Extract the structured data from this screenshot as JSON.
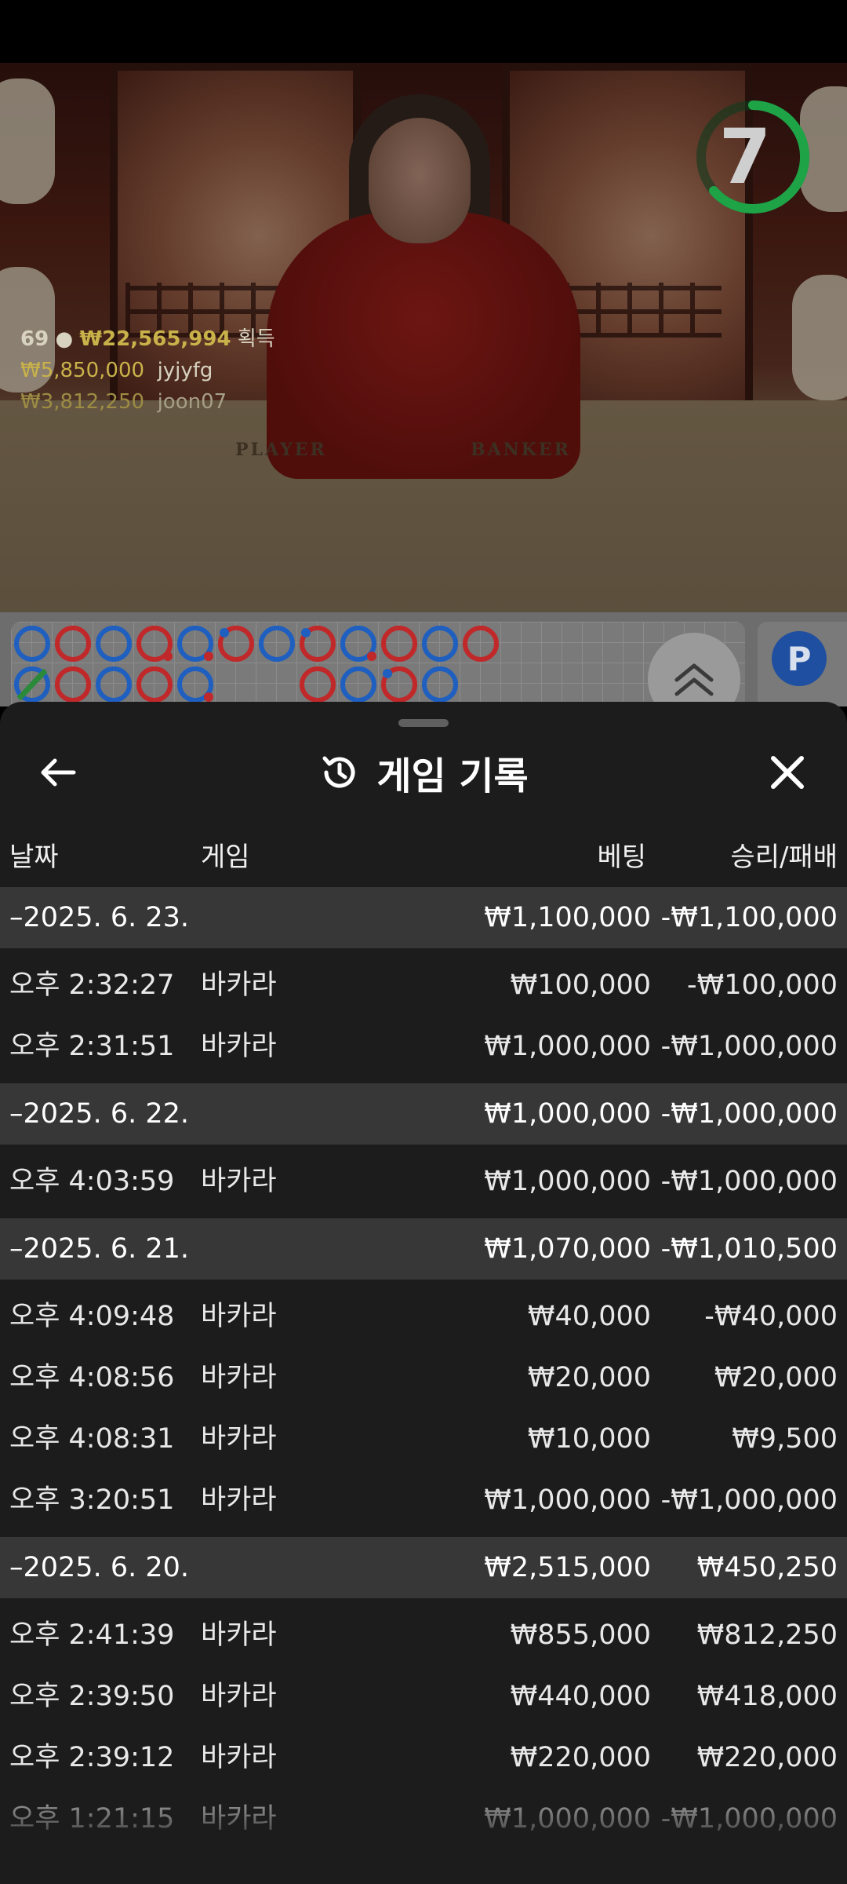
{
  "live": {
    "timer": "7",
    "table_player": "PLAYER",
    "table_banker": "BANKER",
    "stats": {
      "players": "69",
      "total_won": "₩22,565,994",
      "won_label": "획득",
      "winners": [
        {
          "amount": "₩5,850,000",
          "name": "jyjyfg"
        },
        {
          "amount": "₩3,812,250",
          "name": "joon07"
        }
      ]
    },
    "side_badge": "P"
  },
  "colors": {
    "player_blue": "#1f5fbf",
    "banker_red": "#c0282a",
    "timer_green": "#1fa347",
    "tie_green": "#2a8a3a",
    "sheet_bg": "#1c1c1c",
    "date_row_bg": "#373737"
  },
  "sheet": {
    "title": "게임 기록",
    "title_icon": "history-icon",
    "back_icon": "arrow-left-icon",
    "close_icon": "close-icon",
    "columns": {
      "date": "날짜",
      "game": "게임",
      "bet": "베팅",
      "result": "승리/패배"
    },
    "groups": [
      {
        "date": "–2025. 6. 23.",
        "bet": "₩1,100,000",
        "result": "-₩1,100,000",
        "games": [
          {
            "time": "오후 2:32:27",
            "game": "바카라",
            "bet": "₩100,000",
            "result": "-₩100,000"
          },
          {
            "time": "오후 2:31:51",
            "game": "바카라",
            "bet": "₩1,000,000",
            "result": "-₩1,000,000"
          }
        ]
      },
      {
        "date": "–2025. 6. 22.",
        "bet": "₩1,000,000",
        "result": "-₩1,000,000",
        "games": [
          {
            "time": "오후 4:03:59",
            "game": "바카라",
            "bet": "₩1,000,000",
            "result": "-₩1,000,000"
          }
        ]
      },
      {
        "date": "–2025. 6. 21.",
        "bet": "₩1,070,000",
        "result": "-₩1,010,500",
        "games": [
          {
            "time": "오후 4:09:48",
            "game": "바카라",
            "bet": "₩40,000",
            "result": "-₩40,000"
          },
          {
            "time": "오후 4:08:56",
            "game": "바카라",
            "bet": "₩20,000",
            "result": "₩20,000"
          },
          {
            "time": "오후 4:08:31",
            "game": "바카라",
            "bet": "₩10,000",
            "result": "₩9,500"
          },
          {
            "time": "오후 3:20:51",
            "game": "바카라",
            "bet": "₩1,000,000",
            "result": "-₩1,000,000"
          }
        ]
      },
      {
        "date": "–2025. 6. 20.",
        "bet": "₩2,515,000",
        "result": "₩450,250",
        "games": [
          {
            "time": "오후 2:41:39",
            "game": "바카라",
            "bet": "₩855,000",
            "result": "₩812,250"
          },
          {
            "time": "오후 2:39:50",
            "game": "바카라",
            "bet": "₩440,000",
            "result": "₩418,000"
          },
          {
            "time": "오후 2:39:12",
            "game": "바카라",
            "bet": "₩220,000",
            "result": "₩220,000"
          },
          {
            "time": "오후 1:21:15",
            "game": "바카라",
            "bet": "₩1,000,000",
            "result": "-₩1,000,000"
          }
        ]
      }
    ]
  }
}
